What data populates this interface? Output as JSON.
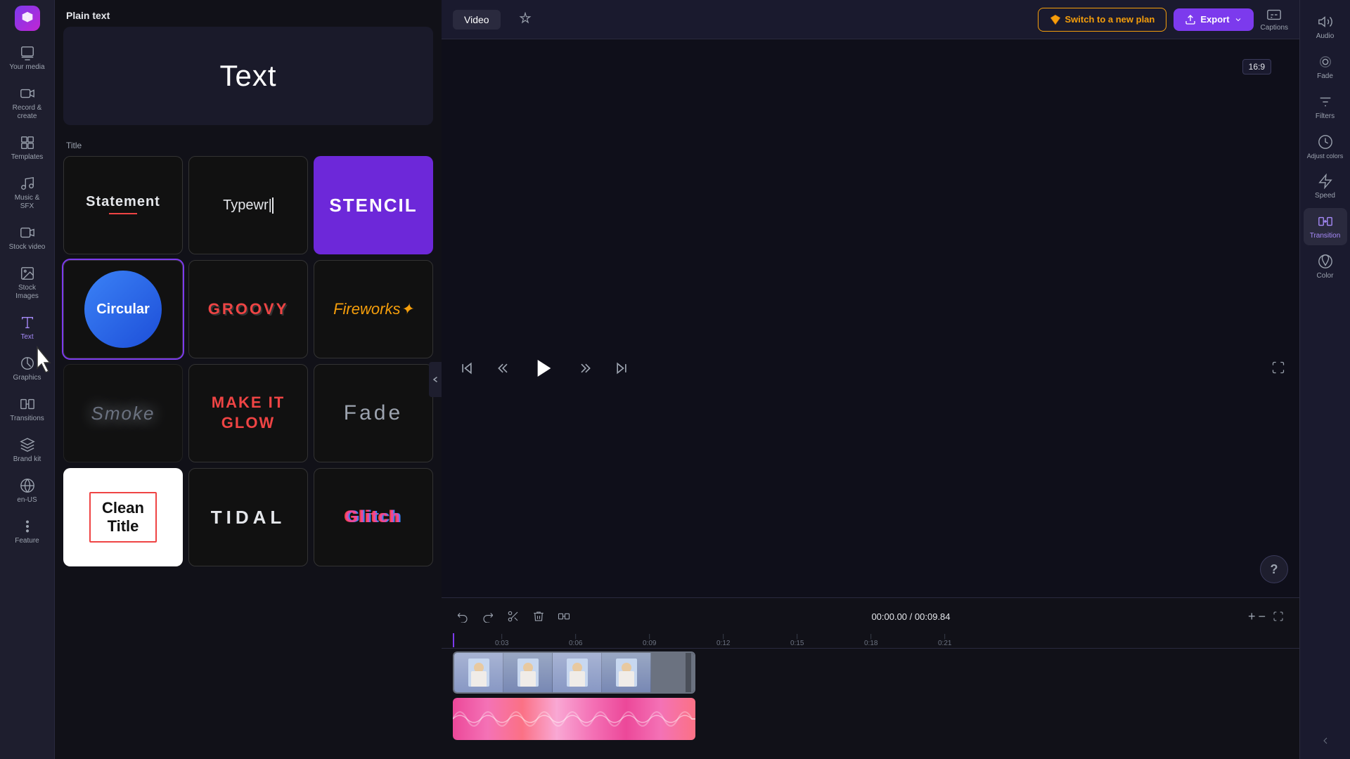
{
  "app": {
    "logo_color": "#7c3aed"
  },
  "sidebar": {
    "items": [
      {
        "id": "your-media",
        "label": "Your media",
        "icon": "media"
      },
      {
        "id": "record-create",
        "label": "Record &\ncreate",
        "icon": "record"
      },
      {
        "id": "templates",
        "label": "Templates",
        "icon": "templates"
      },
      {
        "id": "music-sfx",
        "label": "Music & SFX",
        "icon": "music"
      },
      {
        "id": "stock-video",
        "label": "Stock video",
        "icon": "stock-video"
      },
      {
        "id": "stock-images",
        "label": "Stock images",
        "icon": "stock-images"
      },
      {
        "id": "text",
        "label": "Text",
        "icon": "text",
        "active": true
      },
      {
        "id": "graphics",
        "label": "Graphics",
        "icon": "graphics"
      },
      {
        "id": "transitions",
        "label": "Transitions",
        "icon": "transitions"
      },
      {
        "id": "brand-kit",
        "label": "Brand kit",
        "icon": "brand"
      },
      {
        "id": "en-us",
        "label": "en-US",
        "icon": "lang"
      },
      {
        "id": "feature",
        "label": "...\nFeature",
        "icon": "feature"
      }
    ]
  },
  "panel": {
    "header": "Plain text",
    "sections": [
      {
        "id": "plain-text",
        "label": "",
        "items": [
          {
            "id": "plain-text-card",
            "text": "Text",
            "style": "plain"
          }
        ]
      },
      {
        "id": "title",
        "label": "Title",
        "items": [
          {
            "id": "statement",
            "text": "Statement",
            "style": "statement"
          },
          {
            "id": "typewr",
            "text": "Typewr",
            "style": "typewr"
          },
          {
            "id": "stencil",
            "text": "Stencil",
            "style": "stencil"
          },
          {
            "id": "circular",
            "text": "Circular",
            "style": "circular"
          },
          {
            "id": "groovy",
            "text": "GROOVY",
            "style": "groovy"
          },
          {
            "id": "fireworks",
            "text": "Fireworks",
            "style": "fireworks"
          },
          {
            "id": "smoke",
            "text": "Smoke",
            "style": "smoke"
          },
          {
            "id": "make-it-glow",
            "text": "MAKE IT\nGLOW",
            "style": "glow"
          },
          {
            "id": "fade",
            "text": "Fade",
            "style": "fade"
          },
          {
            "id": "clean-title",
            "text": "Clean\nTitle",
            "style": "clean"
          },
          {
            "id": "tidal",
            "text": "TIDAL",
            "style": "tidal"
          },
          {
            "id": "glitch",
            "text": "Glitch",
            "style": "glitch"
          }
        ]
      }
    ]
  },
  "topbar": {
    "tab_video": "Video",
    "switch_plan_label": "Switch to a new plan",
    "export_label": "Export",
    "captions_label": "Captions",
    "aspect_ratio": "16:9"
  },
  "timecode": {
    "current": "00:00.00",
    "total": "00:09.84"
  },
  "timeline": {
    "marks": [
      "0:03",
      "0:06",
      "0:09",
      "0:12",
      "0:15",
      "0:18",
      "0:21"
    ]
  },
  "right_sidebar": {
    "tools": [
      {
        "id": "audio",
        "label": "Audio",
        "icon": "audio"
      },
      {
        "id": "fade",
        "label": "Fade",
        "icon": "fade"
      },
      {
        "id": "filters",
        "label": "Filters",
        "icon": "filters"
      },
      {
        "id": "adjust-colors",
        "label": "Adjust colors",
        "icon": "adjust"
      },
      {
        "id": "speed",
        "label": "Speed",
        "icon": "speed"
      },
      {
        "id": "transition",
        "label": "Transition",
        "icon": "transition",
        "active": true
      },
      {
        "id": "color",
        "label": "Color",
        "icon": "color"
      }
    ]
  }
}
